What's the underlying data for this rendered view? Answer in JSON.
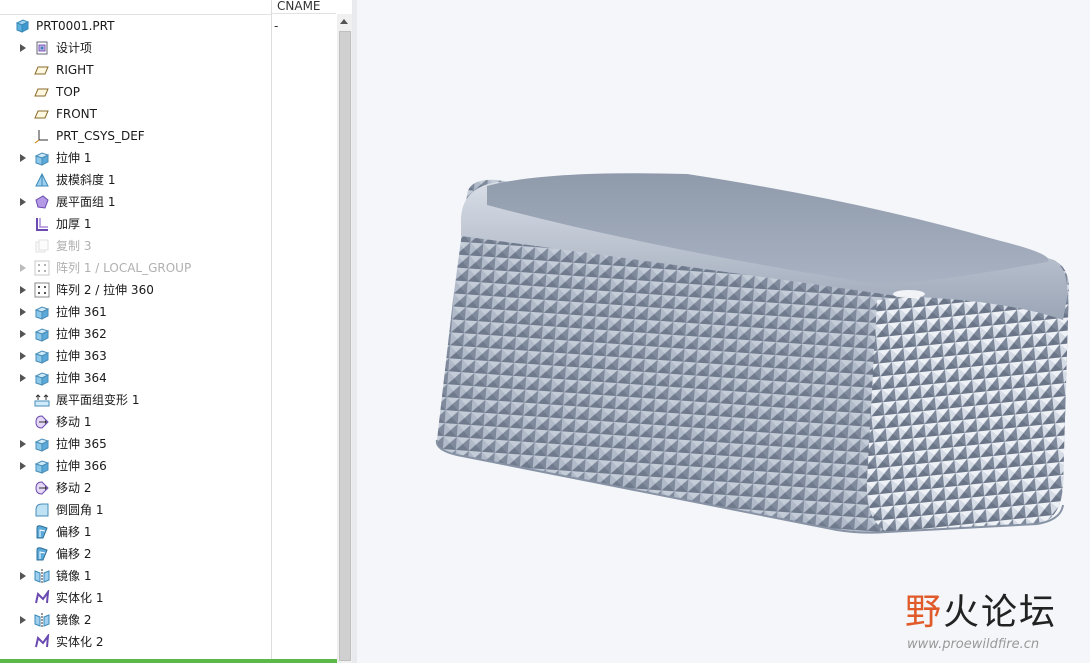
{
  "tree": {
    "column_cname": "CNAME",
    "cname_value": "-",
    "root": {
      "label": "PRT0001.PRT",
      "icon": "part-icon"
    },
    "items": [
      {
        "label": "设计项",
        "icon": "design-items-icon",
        "expandable": true,
        "dim": false
      },
      {
        "label": "RIGHT",
        "icon": "datum-plane-icon",
        "expandable": false,
        "dim": false
      },
      {
        "label": "TOP",
        "icon": "datum-plane-icon",
        "expandable": false,
        "dim": false
      },
      {
        "label": "FRONT",
        "icon": "datum-plane-icon",
        "expandable": false,
        "dim": false
      },
      {
        "label": "PRT_CSYS_DEF",
        "icon": "csys-icon",
        "expandable": false,
        "dim": false
      },
      {
        "label": "拉伸 1",
        "icon": "extrude-icon",
        "expandable": true,
        "dim": false
      },
      {
        "label": "拔模斜度 1",
        "icon": "draft-icon",
        "expandable": false,
        "dim": false
      },
      {
        "label": "展平面组 1",
        "icon": "flatten-quilt-icon",
        "expandable": true,
        "dim": false
      },
      {
        "label": "加厚 1",
        "icon": "thicken-icon",
        "expandable": false,
        "dim": false
      },
      {
        "label": "复制 3",
        "icon": "copy-icon",
        "expandable": false,
        "dim": true
      },
      {
        "label": "阵列 1 / LOCAL_GROUP",
        "icon": "pattern-icon",
        "expandable": true,
        "dim": true
      },
      {
        "label": "阵列 2 / 拉伸 360",
        "icon": "pattern-icon",
        "expandable": true,
        "dim": false
      },
      {
        "label": "拉伸 361",
        "icon": "extrude-icon",
        "expandable": true,
        "dim": false
      },
      {
        "label": "拉伸 362",
        "icon": "extrude-icon",
        "expandable": true,
        "dim": false
      },
      {
        "label": "拉伸 363",
        "icon": "extrude-icon",
        "expandable": true,
        "dim": false
      },
      {
        "label": "拉伸 364",
        "icon": "extrude-icon",
        "expandable": true,
        "dim": false
      },
      {
        "label": "展平面组变形 1",
        "icon": "flatten-deform-icon",
        "expandable": false,
        "dim": false
      },
      {
        "label": "移动 1",
        "icon": "move-icon",
        "expandable": false,
        "dim": false
      },
      {
        "label": "拉伸 365",
        "icon": "extrude-icon",
        "expandable": true,
        "dim": false
      },
      {
        "label": "拉伸 366",
        "icon": "extrude-icon",
        "expandable": true,
        "dim": false
      },
      {
        "label": "移动 2",
        "icon": "move-icon",
        "expandable": false,
        "dim": false
      },
      {
        "label": "倒圆角 1",
        "icon": "round-icon",
        "expandable": false,
        "dim": false
      },
      {
        "label": "偏移 1",
        "icon": "offset-icon",
        "expandable": false,
        "dim": false
      },
      {
        "label": "偏移 2",
        "icon": "offset-icon",
        "expandable": false,
        "dim": false
      },
      {
        "label": "镜像 1",
        "icon": "mirror-icon",
        "expandable": true,
        "dim": false
      },
      {
        "label": "实体化 1",
        "icon": "solidify-icon",
        "expandable": false,
        "dim": false
      },
      {
        "label": "镜像 2",
        "icon": "mirror-icon",
        "expandable": true,
        "dim": false
      },
      {
        "label": "实体化 2",
        "icon": "solidify-icon",
        "expandable": false,
        "dim": false
      }
    ]
  },
  "viewport": {
    "model": "knurled-box-3d-model",
    "background": "#f4f6f9",
    "model_color": "#a9b3c3"
  },
  "watermark": {
    "chinese_text_a": "野",
    "chinese_text_b": "火论坛",
    "url": "www.proewildfire.cn"
  }
}
